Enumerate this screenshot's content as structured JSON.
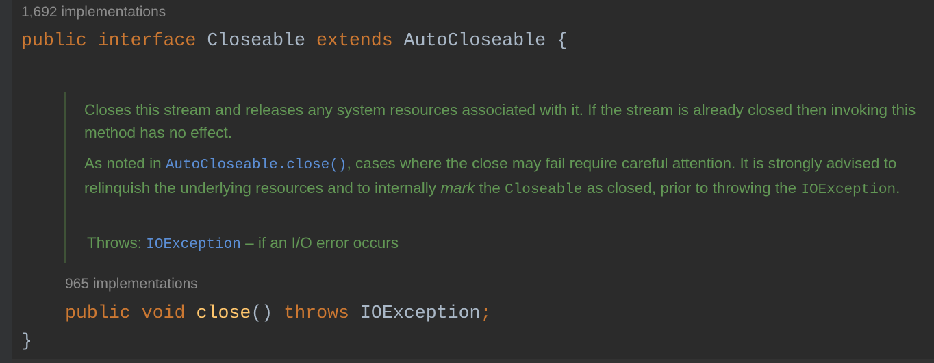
{
  "hints": {
    "interface_impls": "1,692 implementations",
    "method_impls": "965 implementations"
  },
  "decl": {
    "public": "public",
    "interface": "interface",
    "name": "Closeable",
    "extends": "extends",
    "super": "AutoCloseable",
    "brace_open": "{",
    "brace_close": "}"
  },
  "doc": {
    "p1": "Closes this stream and releases any system resources associated with it. If the stream is already closed then invoking this method has no effect.",
    "p2_a": "As noted in ",
    "p2_link": "AutoCloseable.close()",
    "p2_b": ", cases where the close may fail require careful attention. It is strongly advised to relinquish the underlying resources and to internally ",
    "p2_em": "mark",
    "p2_c": " the ",
    "p2_code1": "Closeable",
    "p2_d": " as closed, prior to throwing the ",
    "p2_code2": "IOException",
    "p2_e": ".",
    "throws_label": "Throws: ",
    "throws_link": "IOException",
    "throws_desc": " – if an I/O error occurs"
  },
  "method": {
    "public": "public",
    "void": "void",
    "name": "close",
    "parens": "()",
    "throws": "throws",
    "exception": "IOException",
    "semi": ";"
  }
}
